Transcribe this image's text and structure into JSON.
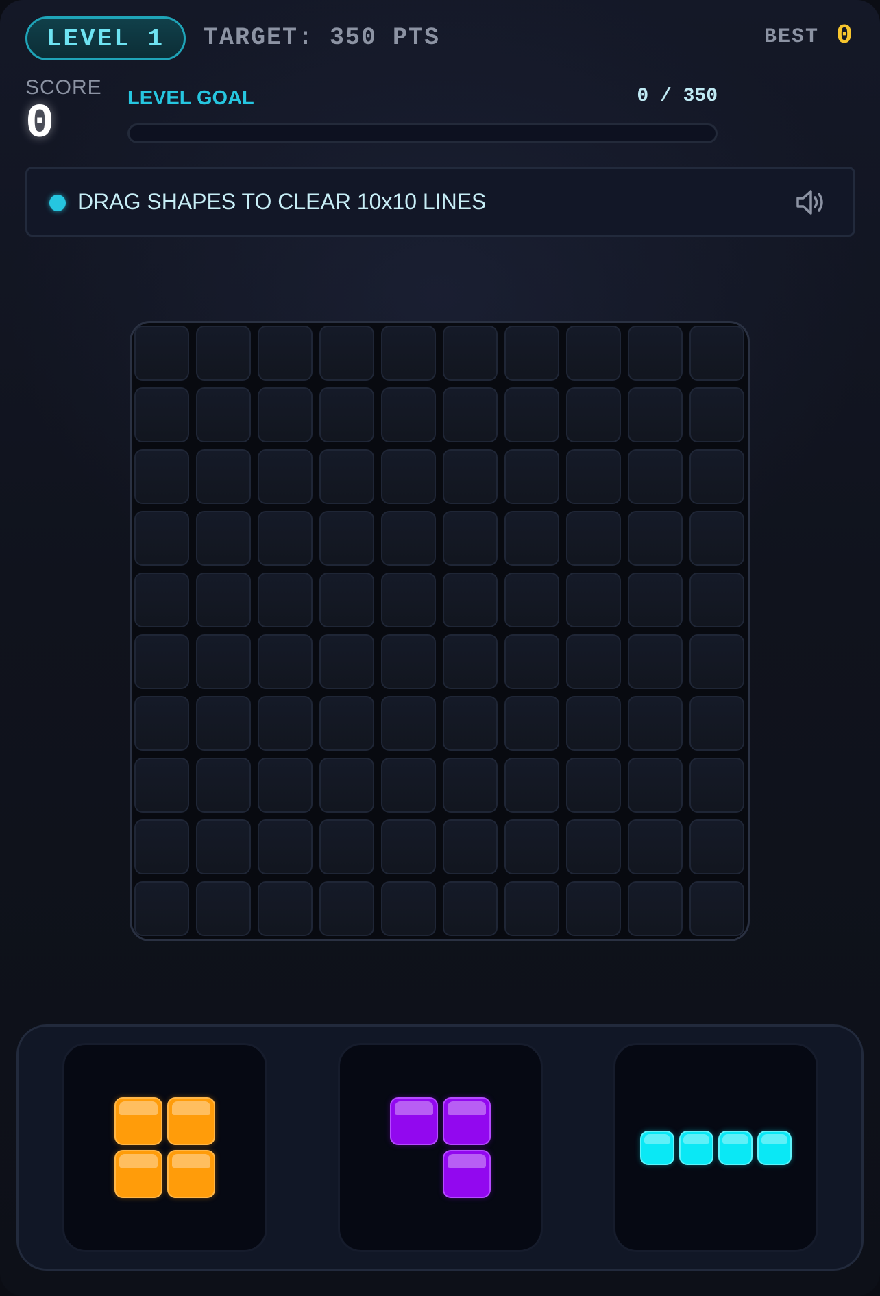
{
  "header": {
    "level_label": "LEVEL 1",
    "target_text": "TARGET: 350 PTS",
    "best_label": "BEST",
    "best_value": "0"
  },
  "score": {
    "label": "SCORE",
    "value": "0"
  },
  "goal": {
    "label": "LEVEL GOAL",
    "value_text": "0 / 350",
    "current": 0,
    "target": 350,
    "progress_fraction": 0
  },
  "banner": {
    "text": "DRAG SHAPES TO CLEAR 10x10 LINES",
    "sound_icon": "speaker-volume-icon"
  },
  "board": {
    "rows": 10,
    "cols": 10,
    "filled_cells": []
  },
  "pieces": [
    {
      "name": "square-2x2",
      "color": "#ff9c0a",
      "cells": [
        [
          0,
          0
        ],
        [
          1,
          0
        ],
        [
          0,
          1
        ],
        [
          1,
          1
        ]
      ]
    },
    {
      "name": "corner-3",
      "color": "#9208ef",
      "cells": [
        [
          0,
          0
        ],
        [
          1,
          0
        ],
        [
          1,
          1
        ]
      ]
    },
    {
      "name": "line-4",
      "color": "#0ae8f5",
      "cells": [
        [
          0,
          0
        ],
        [
          1,
          0
        ],
        [
          2,
          0
        ],
        [
          3,
          0
        ]
      ]
    }
  ],
  "colors": {
    "accent": "#26c6e0",
    "best_value": "#f7c52d",
    "background": "#10131d"
  }
}
